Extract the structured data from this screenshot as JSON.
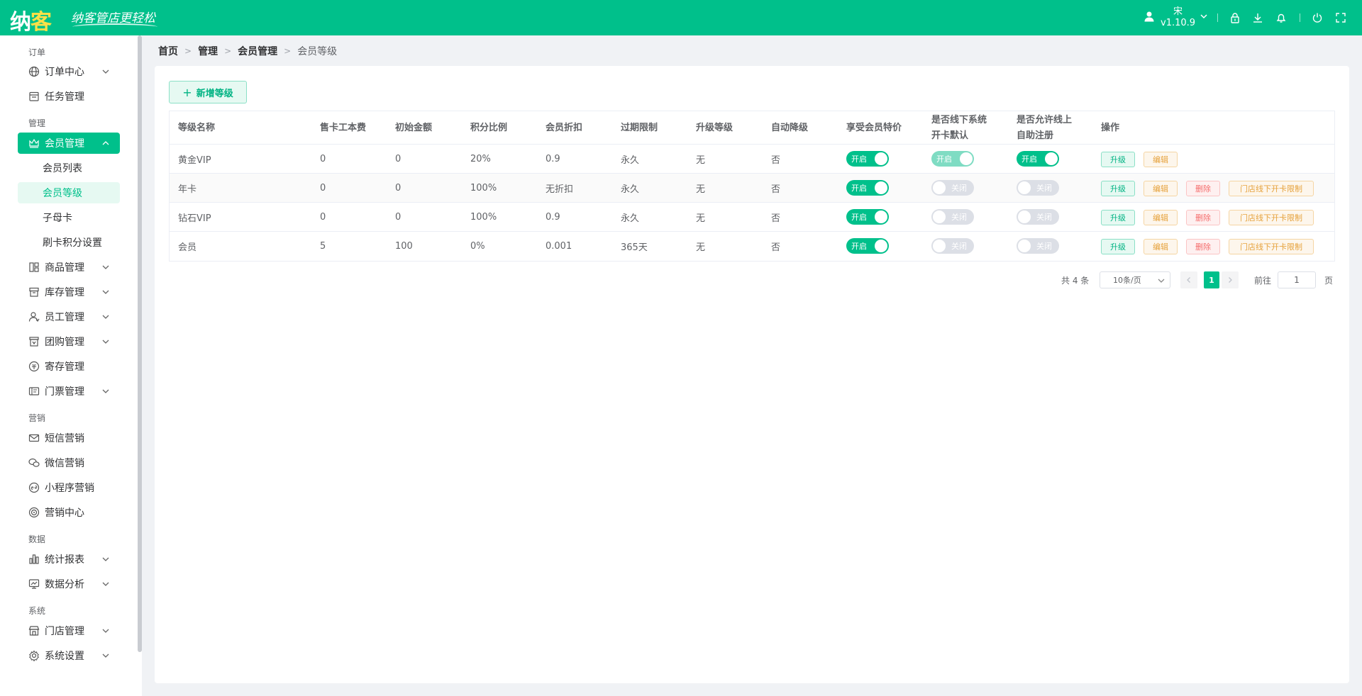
{
  "header": {
    "logo_main": "纳",
    "logo_accent": "客",
    "slogan": "纳客管店更轻松",
    "user_name": "宋",
    "version": "v1.10.9",
    "icons": [
      "user-icon",
      "chevron-down-icon",
      "lock-icon",
      "download-icon",
      "bell-icon",
      "power-icon",
      "fullscreen-icon"
    ]
  },
  "sidebar": {
    "groups": {
      "order": "订单",
      "manage": "管理",
      "marketing": "营销",
      "data": "数据",
      "system": "系统"
    },
    "items": {
      "order_center": "订单中心",
      "task_manage": "任务管理",
      "member_manage": "会员管理",
      "member_list": "会员列表",
      "member_level": "会员等级",
      "parent_child_card": "子母卡",
      "swipe_points": "刷卡积分设置",
      "goods_manage": "商品管理",
      "stock_manage": "库存管理",
      "staff_manage": "员工管理",
      "group_buy": "团购管理",
      "deposit": "寄存管理",
      "ticket": "门票管理",
      "sms": "短信营销",
      "wechat": "微信营销",
      "mini_program": "小程序营销",
      "marketing_center": "营销中心",
      "stats_report": "统计报表",
      "data_analysis": "数据分析",
      "store_manage": "门店管理",
      "system_settings": "系统设置"
    }
  },
  "breadcrumb": [
    "首页",
    "管理",
    "会员管理",
    "会员等级"
  ],
  "toolbar": {
    "add_label": "新增等级"
  },
  "table": {
    "headers": {
      "name": "等级名称",
      "card_fee": "售卡工本费",
      "init_amount": "初始金额",
      "points_ratio": "积分比例",
      "discount": "会员折扣",
      "expiry": "过期限制",
      "upgrade_level": "升级等级",
      "auto_downgrade": "自动降级",
      "special_price_line1": "享受会员特价",
      "offline_default_line1": "是否线下系统",
      "offline_default_line2": "开卡默认",
      "online_register_line1": "是否允许线上",
      "online_register_line2": "自助注册",
      "actions": "操作"
    },
    "switch_on": "开启",
    "switch_off": "关闭",
    "btn_upgrade": "升级",
    "btn_edit": "编辑",
    "btn_delete": "删除",
    "btn_limit": "门店线下开卡限制",
    "rows": [
      {
        "name": "黄金VIP",
        "card_fee": "0",
        "init_amount": "0",
        "points_ratio": "20%",
        "discount": "0.9",
        "expiry": "永久",
        "upgrade_level": "无",
        "auto_downgrade": "否",
        "special_price": true,
        "offline_default": true,
        "online_register": true
      },
      {
        "name": "年卡",
        "card_fee": "0",
        "init_amount": "0",
        "points_ratio": "100%",
        "discount": "无折扣",
        "expiry": "永久",
        "upgrade_level": "无",
        "auto_downgrade": "否",
        "special_price": true,
        "offline_default": false,
        "online_register": false
      },
      {
        "name": "钻石VIP",
        "card_fee": "0",
        "init_amount": "0",
        "points_ratio": "100%",
        "discount": "0.9",
        "expiry": "永久",
        "upgrade_level": "无",
        "auto_downgrade": "否",
        "special_price": true,
        "offline_default": false,
        "online_register": false
      },
      {
        "name": "会员",
        "card_fee": "5",
        "init_amount": "100",
        "points_ratio": "0%",
        "discount": "0.001",
        "expiry": "365天",
        "upgrade_level": "无",
        "auto_downgrade": "否",
        "special_price": true,
        "offline_default": false,
        "online_register": false
      }
    ]
  },
  "pagination": {
    "total": "共 4 条",
    "page_size": "10条/页",
    "current_page": "1",
    "goto_label": "前往",
    "goto_value": "1",
    "page_suffix": "页"
  },
  "colors": {
    "brand": "#00c08b",
    "edit": "#e6a23c",
    "danger": "#f56c6c"
  }
}
